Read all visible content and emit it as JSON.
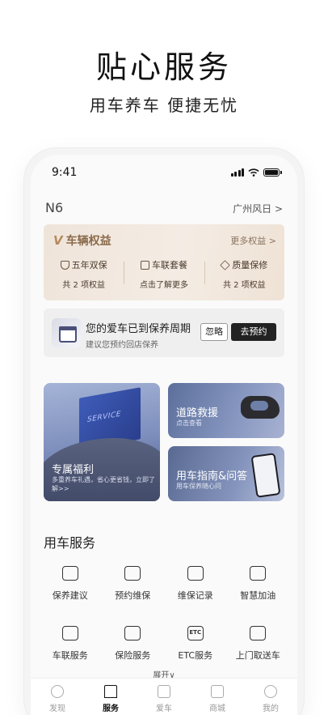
{
  "hero": {
    "title": "贴心服务",
    "subtitle": "用车养车  便捷无忧"
  },
  "status_bar": {
    "time": "9:41"
  },
  "car": {
    "model": "N6",
    "dealer": "广州风日 >"
  },
  "benefits": {
    "title": "车辆权益",
    "more": "更多权益 >",
    "items": [
      {
        "name": "五年双保",
        "desc": "共 2 项权益",
        "icon": "shield-check-icon"
      },
      {
        "name": "车联套餐",
        "desc": "点击了解更多",
        "icon": "sim-card-icon"
      },
      {
        "name": "质量保修",
        "desc": "共 2 项权益",
        "icon": "diamond-icon"
      }
    ]
  },
  "reminder": {
    "title": "您的爱车已到保养周期",
    "subtitle": "建议您预约回店保养",
    "ignore": "忽略",
    "book": "去预约"
  },
  "promo": {
    "welfare": {
      "badge": "SERVICE",
      "title": "专属福利",
      "desc": "多重养车礼遇，省心更省钱，立即了解>>"
    },
    "rescue": {
      "title": "道路救援",
      "subtitle": "点击查看"
    },
    "guide": {
      "title": "用车指南&问答",
      "subtitle": "用车保养随心问"
    }
  },
  "services": {
    "title": "用车服务",
    "items": [
      {
        "label": "保养建议",
        "icon": "smile-card-icon"
      },
      {
        "label": "预约维保",
        "icon": "schedule-icon"
      },
      {
        "label": "维保记录",
        "icon": "clipboard-icon"
      },
      {
        "label": "智慧加油",
        "icon": "fuel-icon"
      },
      {
        "label": "车联服务",
        "icon": "connected-car-icon"
      },
      {
        "label": "保险服务",
        "icon": "car-shield-icon"
      },
      {
        "label": "ETC服务",
        "icon": "etc-icon"
      },
      {
        "label": "上门取送车",
        "icon": "car-pickup-icon"
      }
    ],
    "expand": "展开∨"
  },
  "tabs": [
    {
      "label": "发现",
      "icon": "compass-icon",
      "active": false
    },
    {
      "label": "服务",
      "icon": "bookmark-icon",
      "active": true
    },
    {
      "label": "爱车",
      "icon": "car-icon",
      "active": false
    },
    {
      "label": "商城",
      "icon": "store-icon",
      "active": false
    },
    {
      "label": "我的",
      "icon": "profile-icon",
      "active": false
    }
  ]
}
